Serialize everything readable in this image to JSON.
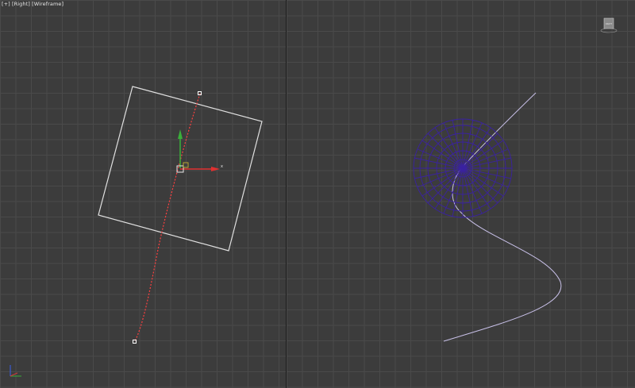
{
  "viewport_left": {
    "label_menu": "[+]",
    "label_view": "[Right]",
    "label_shading": "[Wireframe]",
    "gizmo_x_label": "x",
    "axis_indicator": {
      "x_color": "#d03a3a",
      "y_color": "#3a9a3a",
      "z_color": "#3a5ad0"
    }
  },
  "viewport_right": {
    "viewcube_label": "RIGHT"
  },
  "colors": {
    "background": "#3c3c3c",
    "grid": "#4a4a4a",
    "selected_path": "#ff4040",
    "plane_outline": "#e0e0e0",
    "sphere_wire": "#3a22a0",
    "path": "#c8c0e8"
  }
}
